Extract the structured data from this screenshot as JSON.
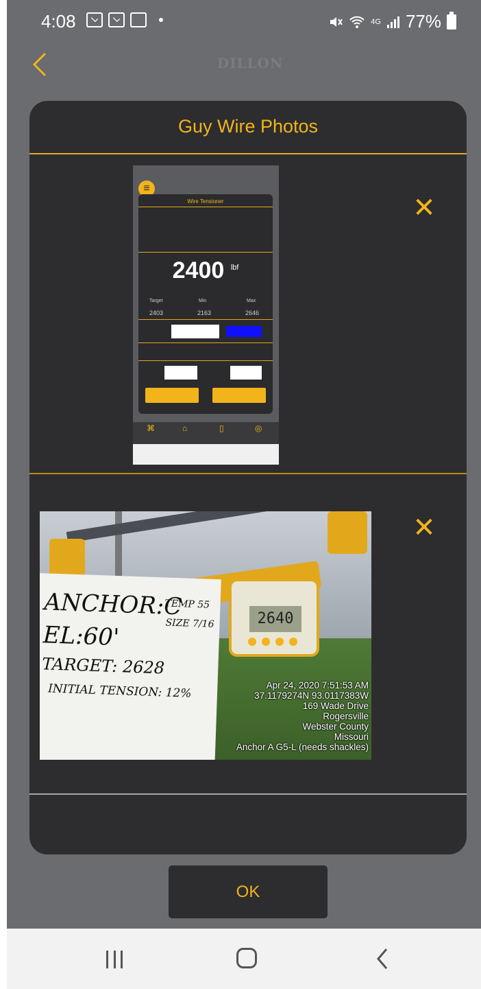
{
  "status_bar": {
    "time": "4:08",
    "network": "4G",
    "battery": "77%"
  },
  "header": {
    "back_icon": "chevron-left-icon",
    "brand": "DILLON"
  },
  "dialog": {
    "title": "Guy Wire Photos",
    "photos": [
      {
        "kind": "app-screenshot",
        "screen_title": "Wire Tensioner",
        "reading_value": "2400",
        "reading_unit": "lbf",
        "target_label": "Target",
        "min_label": "Min",
        "max_label": "Max",
        "target": "2403",
        "min": "2163",
        "max": "2646"
      },
      {
        "kind": "field-photo",
        "gauge_reading": "2640",
        "note_lines": [
          "ANCHOR:C",
          "EL:60'",
          "TARGET: 2628",
          "INITIAL TENSION: 12%"
        ],
        "note_side_lines": [
          "TEMP 55",
          "SIZE 7/16"
        ],
        "stamp_lines": [
          "Apr 24, 2020 7:51:53 AM",
          "37.1179274N 93.0117383W",
          "169 Wade Drive",
          "Rogersville",
          "Webster County",
          "Missouri",
          "Anchor A G5-L (needs shackles)"
        ]
      }
    ],
    "remove_label": "✕"
  },
  "ok_button": {
    "label": "OK"
  },
  "colors": {
    "accent": "#f2b41a",
    "dialog_bg": "#2d2d2f",
    "screen_bg": "#6a6c6f"
  }
}
